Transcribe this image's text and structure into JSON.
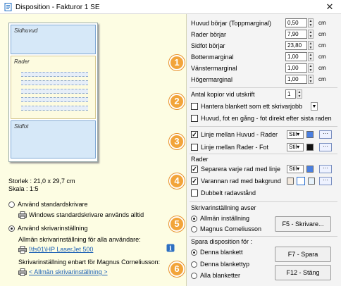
{
  "window": {
    "title": "Disposition - Fakturor 1 SE",
    "close": "✕"
  },
  "preview": {
    "head": "Sidhuvud",
    "rows": "Rader",
    "foot": "Sidfot"
  },
  "size": {
    "storlek": "Storlek : 21,0 x 29,7 cm",
    "skala": "Skala : 1:5"
  },
  "printer": {
    "std_label": "Använd standardskrivare",
    "std_sub": "Windows standardskrivare används alltid",
    "own_label": "Använd skrivarinställning",
    "all_users": "Allmän skrivarinställning för alla användare:",
    "all_users_link": "\\\\fs01\\HP LaserJet 500",
    "only_user": "Skrivarinställning enbart för Magnus Corneliusson:",
    "only_user_link": "< Allmän skrivarinställning >"
  },
  "margins": [
    {
      "label": "Huvud börjar (Toppmarginal)",
      "value": "0,50"
    },
    {
      "label": "Rader börjar",
      "value": "7,90"
    },
    {
      "label": "Sidfot börjar",
      "value": "23,80"
    },
    {
      "label": "Bottenmarginal",
      "value": "1,00"
    },
    {
      "label": "Vänstermarginal",
      "value": "1,00"
    },
    {
      "label": "Högermarginal",
      "value": "1,00"
    }
  ],
  "unit": "cm",
  "copies": {
    "label": "Antal kopior vid utskrift",
    "value": "1"
  },
  "opts2": {
    "hantera": "Hantera blankett som ett skrivarjobb",
    "huvud": "Huvud, fot en gång - fot direkt efter sista raden"
  },
  "lines": {
    "linje1": "Linje mellan Huvud - Rader",
    "linje2": "Linje mellan Rader - Fot",
    "stil": "Stil",
    "dots": "···",
    "rader": "Rader",
    "separera": "Separera varje rad med linje",
    "varannan": "Varannan rad med bakgrund",
    "dubbelt": "Dubbelt radavstånd"
  },
  "avser": {
    "title": "Skrivarinställning avser",
    "allman": "Allmän inställning",
    "user": "Magnus Corneliusson",
    "btn": "F5 - Skrivare..."
  },
  "spara": {
    "title": "Spara disposition för :",
    "denna": "Denna blankett",
    "typ": "Denna blankettyp",
    "alla": "Alla blanketter",
    "btn_spara": "F7 - Spara",
    "btn_stang": "F12 - Stäng"
  },
  "badges": [
    "1",
    "2",
    "3",
    "4",
    "5",
    "6"
  ],
  "colors": {
    "blue_swatch": "#4a7fe0",
    "black_swatch": "#111111",
    "badge": "#f2a43a"
  }
}
